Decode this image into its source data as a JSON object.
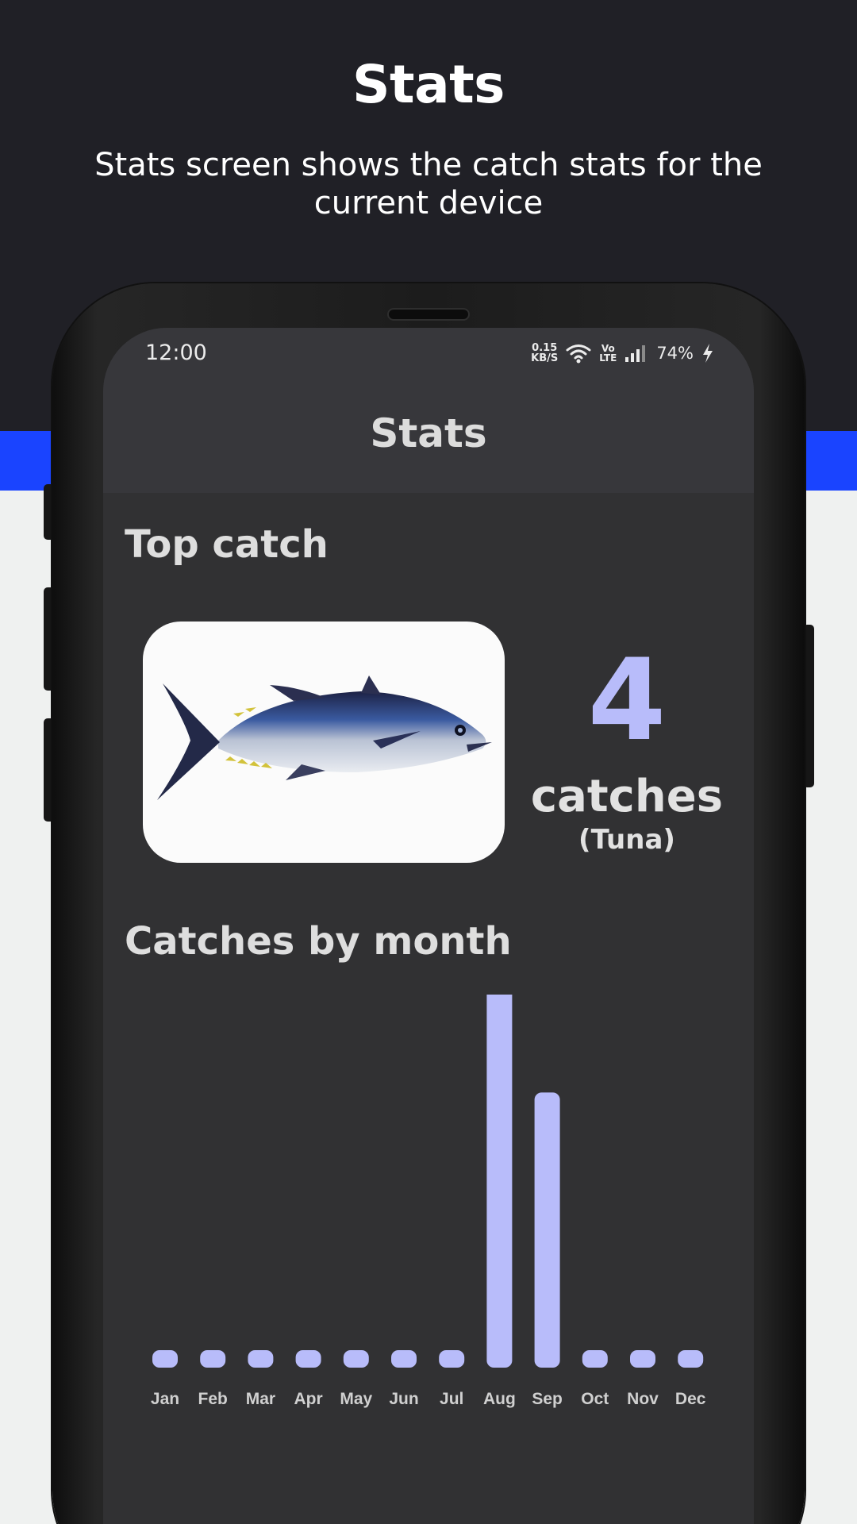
{
  "promo": {
    "title": "Stats",
    "subtitle": "Stats screen shows the catch stats for the current device"
  },
  "status_bar": {
    "time": "12:00",
    "net_speed_value": "0.15",
    "net_speed_unit": "KB/S",
    "volte_top": "Vo",
    "volte_bottom": "LTE",
    "battery": "74%",
    "icons": [
      "wifi-icon",
      "signal-icon",
      "charging-bolt-icon"
    ]
  },
  "app": {
    "title": "Stats",
    "top_catch": {
      "heading": "Top catch",
      "image": "tuna-fish-image",
      "count": "4",
      "count_label": "catches",
      "species": "(Tuna)"
    },
    "monthly": {
      "heading": "Catches by month"
    }
  },
  "colors": {
    "accent": "#b8bcfa",
    "blue_band": "#1a44ff",
    "dark_bg": "#202026",
    "screen_bg": "#313133"
  },
  "chart_data": {
    "type": "bar",
    "categories": [
      "Jan",
      "Feb",
      "Mar",
      "Apr",
      "May",
      "Jun",
      "Jul",
      "Aug",
      "Sep",
      "Oct",
      "Nov",
      "Dec"
    ],
    "values": [
      0,
      0,
      0,
      0,
      0,
      0,
      0,
      3,
      2,
      0,
      0,
      0
    ],
    "ylim": [
      0,
      3
    ],
    "grid": false,
    "title": "Catches by month"
  }
}
